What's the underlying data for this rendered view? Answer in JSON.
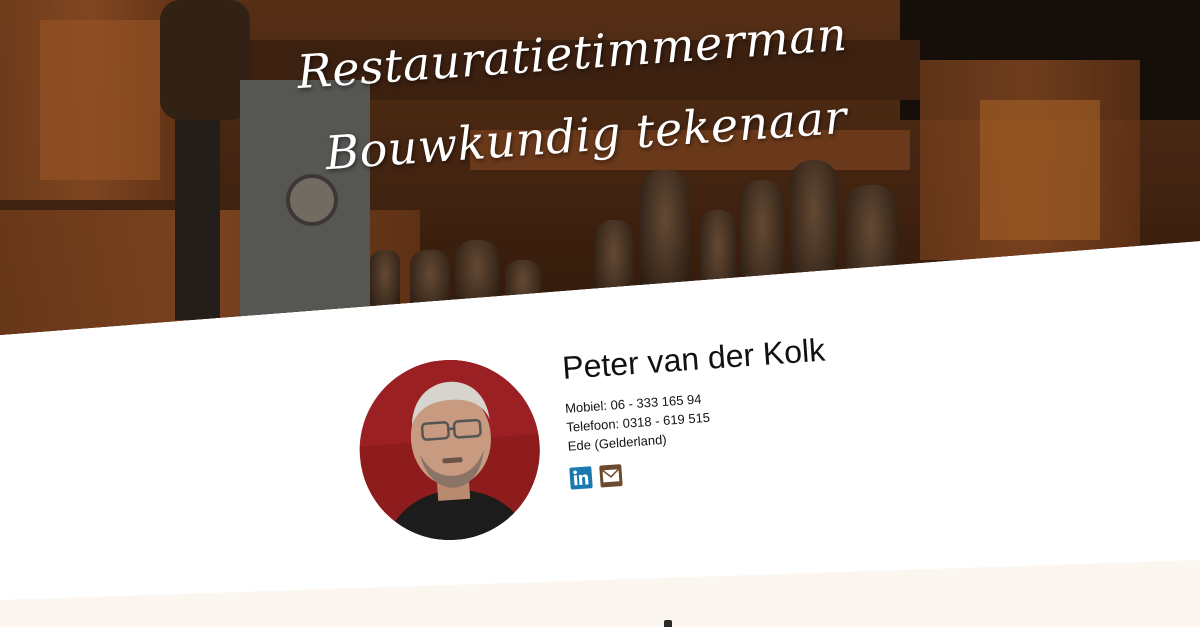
{
  "hero": {
    "title_line1": "Restauratietimmerman",
    "title_line2": "Bouwkundig tekenaar"
  },
  "profile": {
    "name": "Peter van der Kolk",
    "mobile": "Mobiel: 06 - 333 165 94",
    "phone": "Telefoon: 0318 - 619 515",
    "location": "Ede (Gelderland)",
    "social": [
      {
        "icon": "linkedin-icon",
        "label": "in"
      },
      {
        "icon": "mail-icon"
      }
    ]
  },
  "colors": {
    "linkedin": "#1a7aaf",
    "mail": "#6b4a30",
    "band": "#fbf6ef",
    "avatar_bg": "#8e1c1c"
  }
}
